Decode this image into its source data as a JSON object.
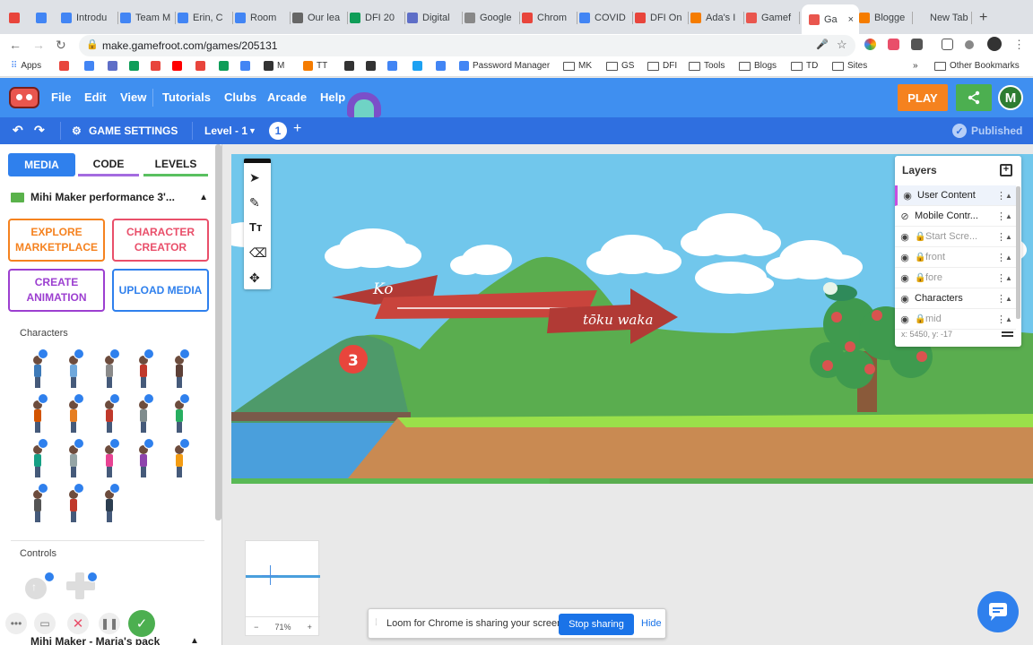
{
  "browser": {
    "tabs": [
      {
        "label": "Introdu",
        "color": "#4285f4"
      },
      {
        "label": "Team M",
        "color": "#4285f4"
      },
      {
        "label": "Erin, C",
        "color": "#4285f4"
      },
      {
        "label": "Room",
        "color": "#4285f4"
      },
      {
        "label": "Our lea",
        "color": "#666666"
      },
      {
        "label": "DFI 20",
        "color": "#0f9d58"
      },
      {
        "label": "Digital",
        "color": "#5e6ec7"
      },
      {
        "label": "Google",
        "color": "#888888"
      },
      {
        "label": "Chrom",
        "color": "#e8453c"
      },
      {
        "label": "COVID",
        "color": "#4285f4"
      },
      {
        "label": "DFI On",
        "color": "#e8453c"
      },
      {
        "label": "Ada's I",
        "color": "#f57c00"
      },
      {
        "label": "Gamef",
        "color": "#e9564e"
      },
      {
        "label": "Ga",
        "color": "#e9564e"
      },
      {
        "label": "Blogge",
        "color": "#f57c00"
      },
      {
        "label": "New Tab",
        "color": "#dee1e6"
      }
    ],
    "url": "make.gamefroot.com/games/205131",
    "bookmarks": [
      {
        "label": "Apps",
        "color": "#4285f4"
      },
      {
        "label": "M",
        "color": "#e8453c"
      },
      {
        "label": "TT",
        "color": "#f57c00"
      },
      {
        "label": "Password Manager",
        "color": "#4285f4"
      },
      {
        "label": "MK",
        "color": "folder"
      },
      {
        "label": "GS",
        "color": "folder"
      },
      {
        "label": "DFI",
        "color": "folder"
      },
      {
        "label": "Tools",
        "color": "folder"
      },
      {
        "label": "Blogs",
        "color": "folder"
      },
      {
        "label": "TD",
        "color": "folder"
      },
      {
        "label": "Sites",
        "color": "folder"
      },
      {
        "label": "»",
        "color": "none"
      },
      {
        "label": "Other Bookmarks",
        "color": "folder"
      }
    ]
  },
  "app": {
    "menu": [
      "File",
      "Edit",
      "View",
      "Tutorials",
      "Clubs",
      "Arcade",
      "Help"
    ],
    "play_label": "PLAY",
    "avatar_initial": "M",
    "game_settings_label": "GAME SETTINGS",
    "level_label": "Level - 1",
    "level_number": "1",
    "published_label": "Published"
  },
  "left_panel": {
    "tabs": [
      "MEDIA",
      "CODE",
      "LEVELS"
    ],
    "pack_title": "Mihi Maker performance 3'...",
    "buttons": [
      {
        "label": "EXPLORE MARKETPLACE",
        "color": "#f5821f"
      },
      {
        "label": "CHARACTER CREATOR",
        "color": "#e94f6a"
      },
      {
        "label": "CREATE ANIMATION",
        "color": "#9c3fd0"
      },
      {
        "label": "UPLOAD MEDIA",
        "color": "#2f80ed"
      }
    ],
    "characters_label": "Characters",
    "controls_label": "Controls",
    "second_pack_title": "Mihi Maker - Maria's pack"
  },
  "scene": {
    "banner_left": "Ko",
    "banner_right": "tōku waka",
    "step_number": "3"
  },
  "layers": {
    "title": "Layers",
    "rows": [
      {
        "name": "User Content",
        "eye": "visible",
        "locked": false,
        "active": true
      },
      {
        "name": "Mobile Contr...",
        "eye": "hidden",
        "locked": false,
        "active": false
      },
      {
        "name": "Start Scre...",
        "eye": "visible",
        "locked": true,
        "active": false
      },
      {
        "name": "front",
        "eye": "visible",
        "locked": true,
        "active": false
      },
      {
        "name": "fore",
        "eye": "visible",
        "locked": true,
        "active": false
      },
      {
        "name": "Characters",
        "eye": "visible",
        "locked": false,
        "active": false
      },
      {
        "name": "mid",
        "eye": "visible",
        "locked": true,
        "active": false
      }
    ],
    "coords": "x: 5450, y: -17"
  },
  "minimap": {
    "zoom": "71%"
  },
  "loom": {
    "message": "Loom for Chrome is sharing your screen.",
    "stop_label": "Stop sharing",
    "hide_label": "Hide"
  }
}
